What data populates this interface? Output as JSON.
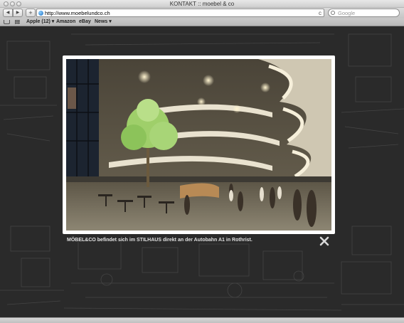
{
  "window": {
    "title": "KONTAKT :: moebel & co"
  },
  "toolbar": {
    "back_label": "◀",
    "forward_label": "▶",
    "add_label": "+",
    "url": "http://www.moebelundco.ch",
    "reload_label": "c",
    "search_placeholder": "Google"
  },
  "bookmarks": [
    {
      "label": "Apple (12) ▾"
    },
    {
      "label": "Amazon"
    },
    {
      "label": "eBay"
    },
    {
      "label": "News ▾"
    }
  ],
  "lightbox": {
    "caption": "MÖBEL&CO befindet sich im STILHAUS direkt an der Autobahn A1 in Rothrist."
  }
}
